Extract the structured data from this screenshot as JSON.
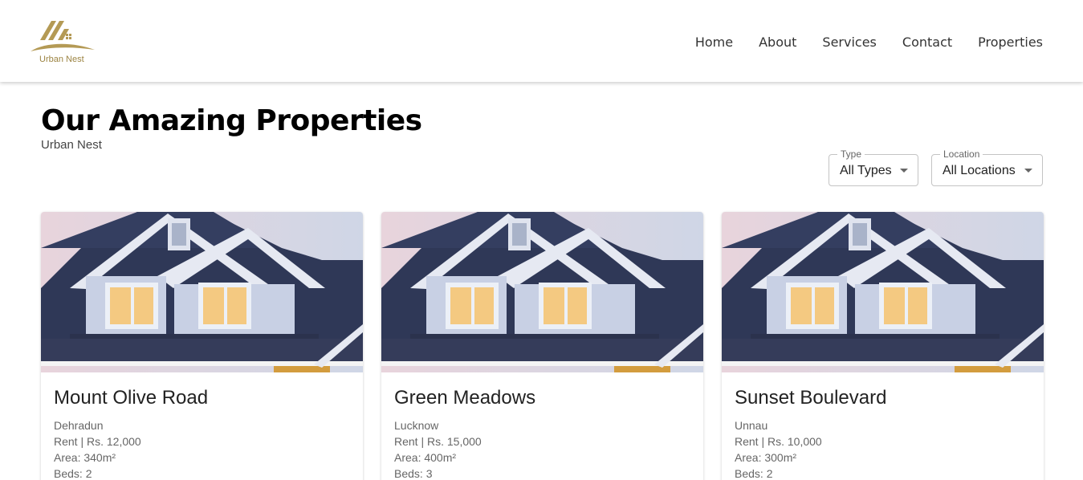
{
  "brand": {
    "name": "Urban Nest",
    "accent_color": "#b49a55"
  },
  "nav": {
    "items": [
      "Home",
      "About",
      "Services",
      "Contact",
      "Properties"
    ]
  },
  "page": {
    "title": "Our Amazing Properties",
    "subtitle": "Urban Nest"
  },
  "filters": {
    "type": {
      "label": "Type",
      "value": "All Types"
    },
    "location": {
      "label": "Location",
      "value": "All Locations"
    }
  },
  "properties": [
    {
      "title": "Mount Olive Road",
      "city": "Dehradun",
      "price": "Rent | Rs. 12,000",
      "area": "Area: 340m²",
      "beds": "Beds: 2"
    },
    {
      "title": "Green Meadows",
      "city": "Lucknow",
      "price": "Rent | Rs. 15,000",
      "area": "Area: 400m²",
      "beds": "Beds: 3"
    },
    {
      "title": "Sunset Boulevard",
      "city": "Unnau",
      "price": "Rent | Rs. 10,000",
      "area": "Area: 300m²",
      "beds": "Beds: 2"
    }
  ]
}
